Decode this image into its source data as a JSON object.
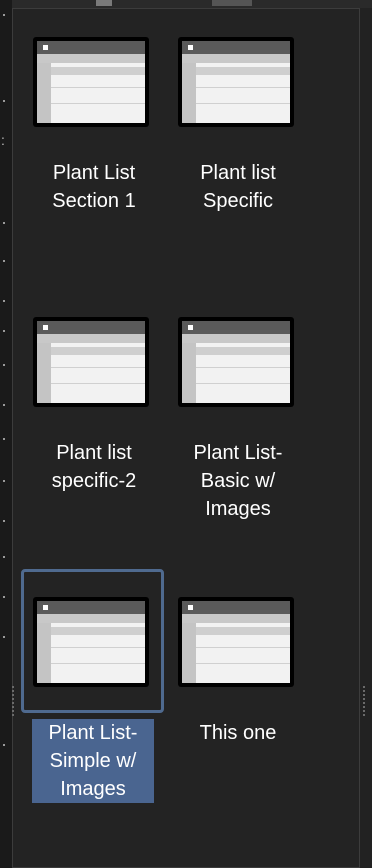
{
  "tiles": [
    {
      "label_line1": "Plant List",
      "label_line2": "Section 1",
      "label_line3": ""
    },
    {
      "label_line1": "Plant list",
      "label_line2": "Specific",
      "label_line3": ""
    },
    {
      "label_line1": "Plant list",
      "label_line2": "specific-2",
      "label_line3": ""
    },
    {
      "label_line1": "Plant List-",
      "label_line2": "Basic w/",
      "label_line3": "Images"
    },
    {
      "label_line1": "Plant List-",
      "label_line2": "Simple w/",
      "label_line3": "Images"
    },
    {
      "label_line1": "This one",
      "label_line2": "",
      "label_line3": ""
    }
  ],
  "colors": {
    "background": "#222222",
    "selection": "#4a6590",
    "selection_border": "#4f6a8f",
    "text": "#ffffff"
  },
  "icons": {
    "template_thumbnail": "table-layout-icon"
  },
  "selected_tile": "Plant List- Simple w/ Images"
}
